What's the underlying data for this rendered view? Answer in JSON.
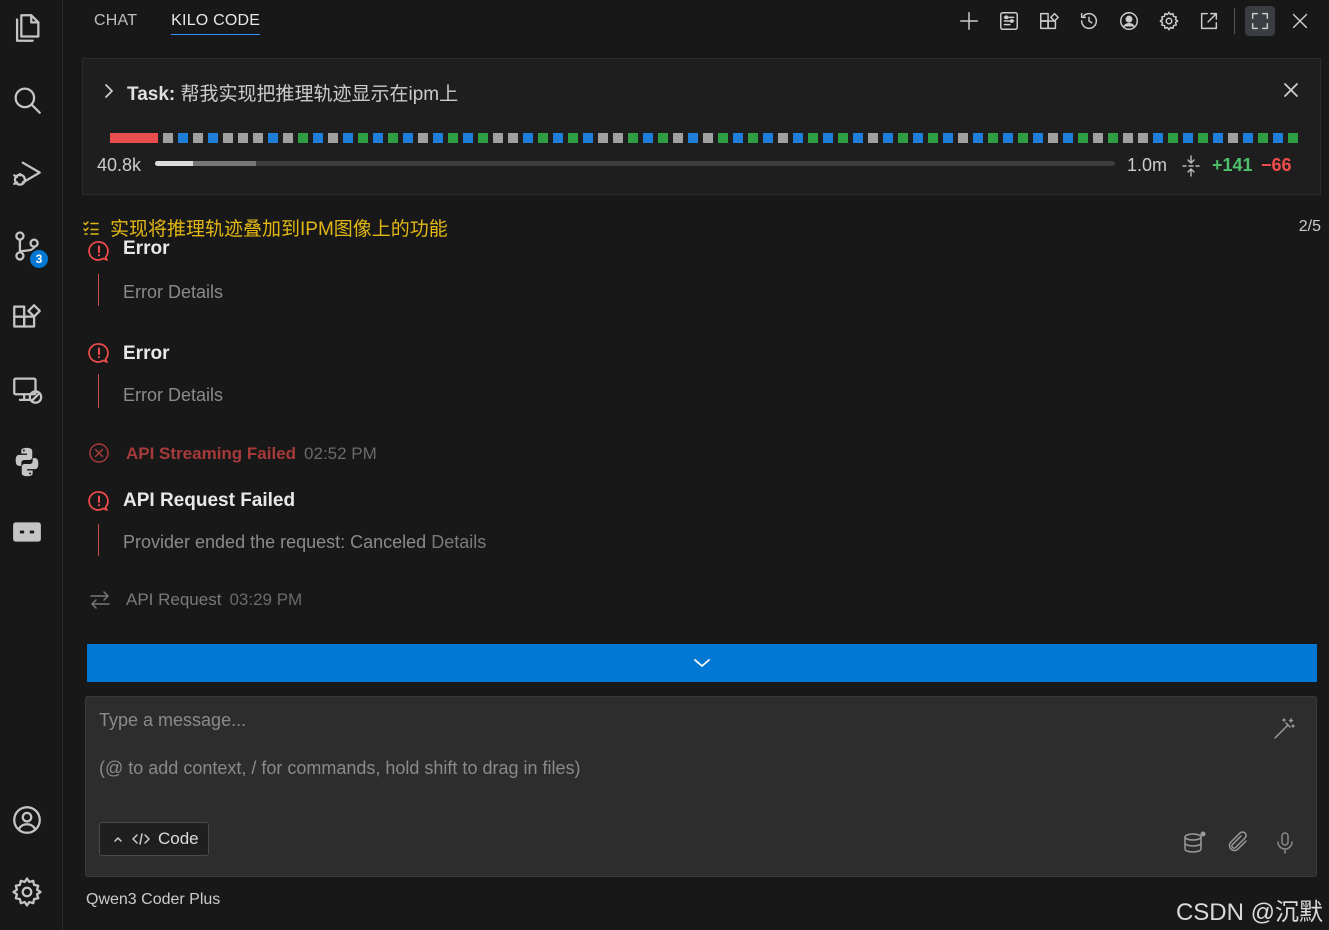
{
  "activity_bar": {
    "icons": [
      "explorer-icon",
      "search-icon",
      "run-debug-icon",
      "source-control-icon",
      "extensions-icon",
      "remote-explorer-icon",
      "python-icon",
      "kilo-code-icon",
      "account-icon",
      "manage-gear-icon"
    ],
    "source_control_badge": "3"
  },
  "tabs": [
    {
      "label": "CHAT",
      "active": false
    },
    {
      "label": "KILO CODE",
      "active": true
    }
  ],
  "top_icons": [
    "plus-icon",
    "prompts-icon",
    "mcp-icon",
    "history-icon",
    "profile-icon",
    "settings-icon",
    "open-in-editor-icon",
    "fullscreen-icon",
    "close-icon"
  ],
  "task": {
    "prefix": "Task:",
    "title": "帮我实现把推理轨迹显示在ipm上",
    "context_used": "40.8k",
    "context_max": "1.0m",
    "context_fill_fraction": 0.04,
    "context_reserved_fraction": 0.065,
    "lines_added": "+141",
    "lines_removed": "−66",
    "timeline": "rgbgbgggbggbgbgbgbgbgbgggbgbgbgggbggbggbgbgbgbgbgbgbgbgbgbgbgbgggggbgbgbgbgbgbgggbgbgbgbgbgB gg",
    "colors": {
      "red": "#e84e4e",
      "gray": "#a0a0a0",
      "blue": "#1f7ed8",
      "green": "#2e9e44"
    }
  },
  "todo": {
    "text": "实现将推理轨迹叠加到IPM图像上的功能",
    "progress": "2/5"
  },
  "messages": [
    {
      "type": "error",
      "title": "Error",
      "detail": "Error Details"
    },
    {
      "type": "error",
      "title": "Error",
      "detail": "Error Details"
    },
    {
      "type": "stream_failed",
      "title": "API Streaming Failed",
      "time": "02:52 PM"
    },
    {
      "type": "request_failed",
      "title": "API Request Failed",
      "detail": "Provider ended the request: Canceled",
      "link": "Details"
    },
    {
      "type": "api_request",
      "title": "API Request",
      "time": "03:29 PM"
    }
  ],
  "input": {
    "placeholder_line1": "Type a message...",
    "placeholder_line2": "(@ to add context, / for commands, hold shift to drag in files)",
    "mode_label": "Code"
  },
  "model_name": "Qwen3 Coder Plus",
  "watermark": "CSDN @沉默"
}
